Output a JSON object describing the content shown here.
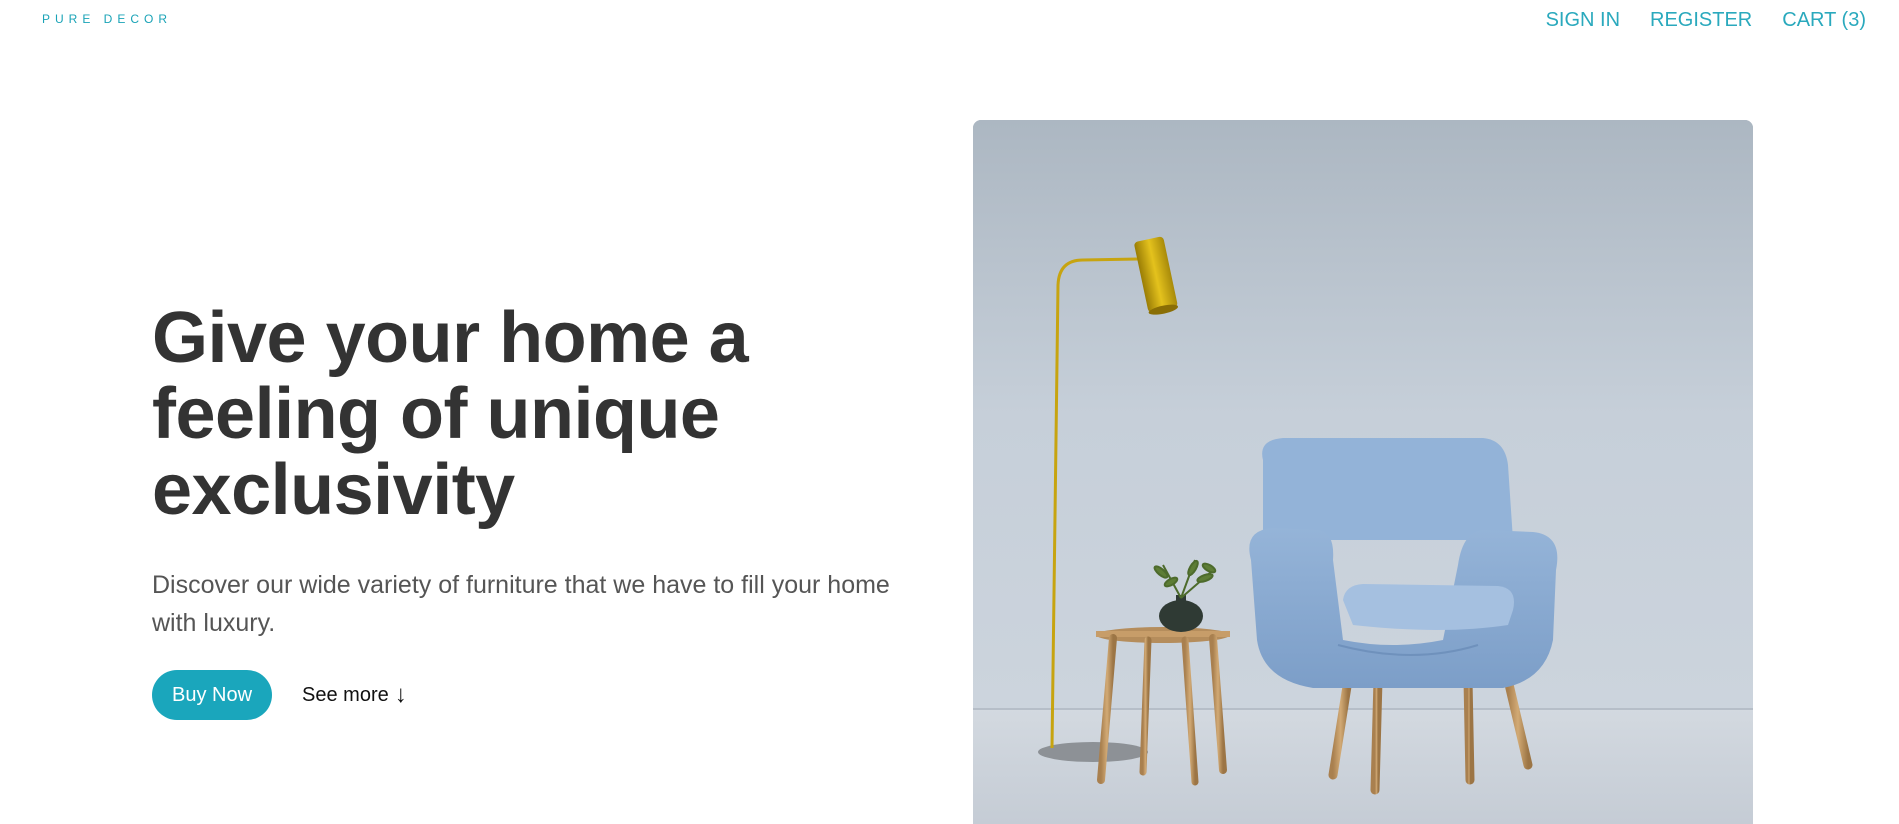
{
  "header": {
    "logo": "PURE DECOR",
    "nav": [
      {
        "label": "SIGN IN"
      },
      {
        "label": "REGISTER"
      },
      {
        "label": "CART (3)"
      }
    ]
  },
  "hero": {
    "headline": "Give your home a feeling of unique exclusivity",
    "subtext": "Discover our wide variety of furniture that we have to fill your home with luxury.",
    "buy_label": "Buy Now",
    "see_more_label": "See more",
    "see_more_arrow": "↓"
  },
  "colors": {
    "accent": "#1aa6bc",
    "headline": "#333333",
    "body_text": "#555555"
  },
  "image": {
    "subject": "light blue armchair with gold floor lamp and wooden side table with plant"
  }
}
